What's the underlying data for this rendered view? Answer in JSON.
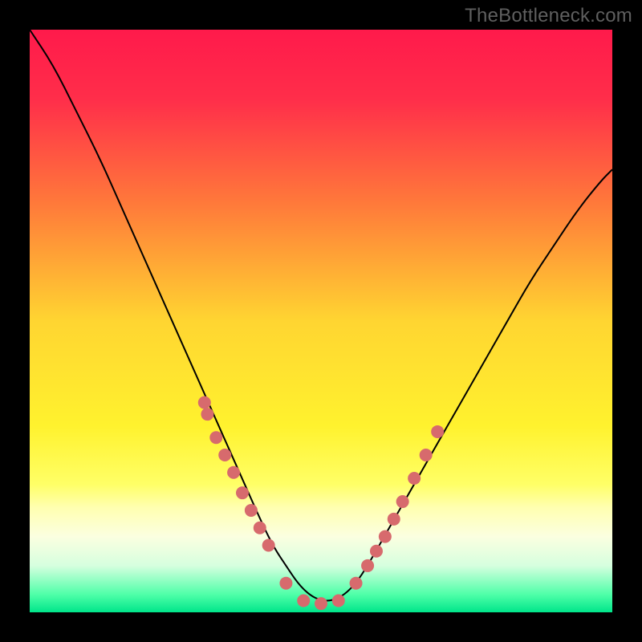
{
  "watermark": "TheBottleneck.com",
  "chart_data": {
    "type": "line",
    "title": "",
    "xlabel": "",
    "ylabel": "",
    "xlim": [
      0,
      100
    ],
    "ylim": [
      0,
      100
    ],
    "grid": false,
    "legend": false,
    "background": {
      "type": "vertical-gradient",
      "stops": [
        {
          "offset": 0.0,
          "color": "#ff1a4b"
        },
        {
          "offset": 0.12,
          "color": "#ff2e4a"
        },
        {
          "offset": 0.3,
          "color": "#ff7a3a"
        },
        {
          "offset": 0.5,
          "color": "#ffd531"
        },
        {
          "offset": 0.68,
          "color": "#fff22e"
        },
        {
          "offset": 0.78,
          "color": "#ffff66"
        },
        {
          "offset": 0.82,
          "color": "#ffffb0"
        },
        {
          "offset": 0.87,
          "color": "#fbffe0"
        },
        {
          "offset": 0.92,
          "color": "#d6ffdf"
        },
        {
          "offset": 0.97,
          "color": "#4dffa8"
        },
        {
          "offset": 1.0,
          "color": "#00e58a"
        }
      ]
    },
    "series": [
      {
        "name": "bottleneck-curve",
        "stroke": "#000000",
        "stroke_width": 2,
        "x": [
          0,
          4,
          8,
          12,
          16,
          20,
          24,
          28,
          32,
          36,
          40,
          42,
          44,
          46,
          48,
          50,
          52,
          54,
          56,
          58,
          62,
          66,
          70,
          74,
          78,
          82,
          86,
          90,
          94,
          98,
          100
        ],
        "y": [
          100,
          94,
          86,
          78,
          69,
          60,
          51,
          42,
          33,
          24,
          15,
          11,
          8,
          5,
          3,
          2,
          2,
          3,
          5,
          8,
          15,
          22,
          29,
          36,
          43,
          50,
          57,
          63,
          69,
          74,
          76
        ]
      }
    ],
    "markers": {
      "name": "datapoints",
      "color": "#d76a6d",
      "radius": 8,
      "x": [
        30.0,
        30.5,
        32.0,
        33.5,
        35.0,
        36.5,
        38.0,
        39.5,
        41.0,
        44.0,
        47.0,
        50.0,
        53.0,
        56.0,
        58.0,
        59.5,
        61.0,
        62.5,
        64.0,
        66.0,
        68.0,
        70.0
      ],
      "y": [
        36.0,
        34.0,
        30.0,
        27.0,
        24.0,
        20.5,
        17.5,
        14.5,
        11.5,
        5.0,
        2.0,
        1.5,
        2.0,
        5.0,
        8.0,
        10.5,
        13.0,
        16.0,
        19.0,
        23.0,
        27.0,
        31.0
      ]
    }
  }
}
